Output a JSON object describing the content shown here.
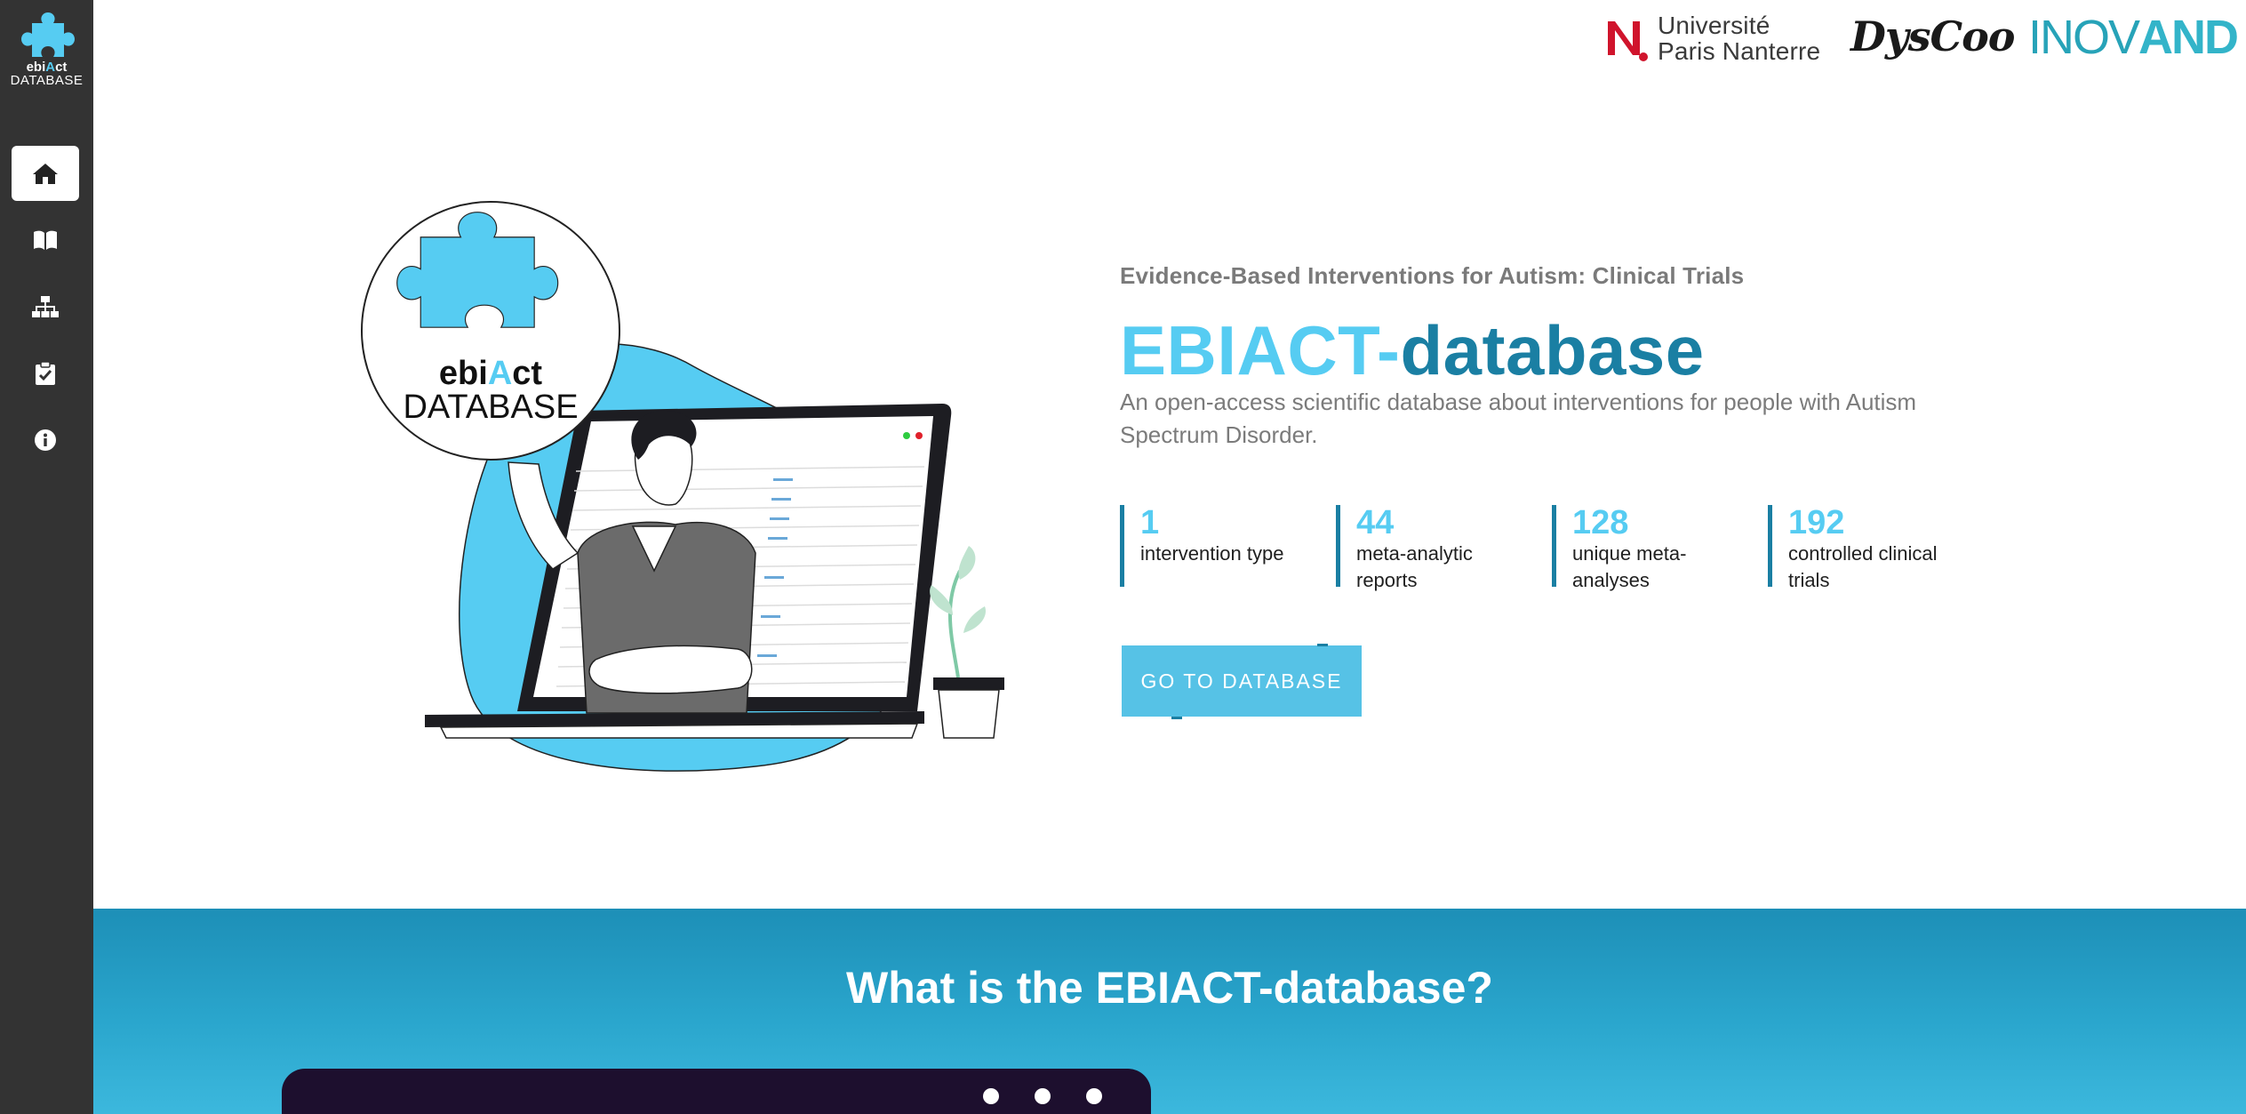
{
  "sidebar": {
    "logo": {
      "line1_a": "ebi",
      "line1_b": "A",
      "line1_c": "ct",
      "line2": "DATABASE"
    },
    "items": [
      {
        "icon": "home-icon",
        "active": true
      },
      {
        "icon": "book-icon",
        "active": false
      },
      {
        "icon": "sitemap-icon",
        "active": false
      },
      {
        "icon": "clipboard-check-icon",
        "active": false
      },
      {
        "icon": "info-icon",
        "active": false
      }
    ]
  },
  "header": {
    "partners": {
      "upn_line1": "Université",
      "upn_line2": "Paris Nanterre",
      "dyscoo": "DysCoo",
      "inovand_a": "INOV",
      "inovand_b": "AND"
    }
  },
  "hero": {
    "kicker": "Evidence-Based Interventions for Autism: Clinical Trials",
    "title_part1": "EBIACT-",
    "title_part2": "database",
    "subtitle": "An open-access scientific database about interventions for people with Autism Spectrum Disorder.",
    "stats": [
      {
        "number": "1",
        "label": "intervention type"
      },
      {
        "number": "44",
        "label": "meta-analytic reports"
      },
      {
        "number": "128",
        "label": "unique meta-analyses"
      },
      {
        "number": "192",
        "label": "controlled clinical trials"
      }
    ],
    "cta_label": "GO TO DATABASE",
    "illustration_logo": {
      "line1_a": "ebi",
      "line1_b": "A",
      "line1_c": "ct",
      "line2": "DATABASE"
    }
  },
  "about": {
    "title": "What is the EBIACT-database?"
  },
  "colors": {
    "accent_light": "#56ccf2",
    "accent_dark": "#1a7fa3",
    "sidebar_bg": "#333333"
  }
}
